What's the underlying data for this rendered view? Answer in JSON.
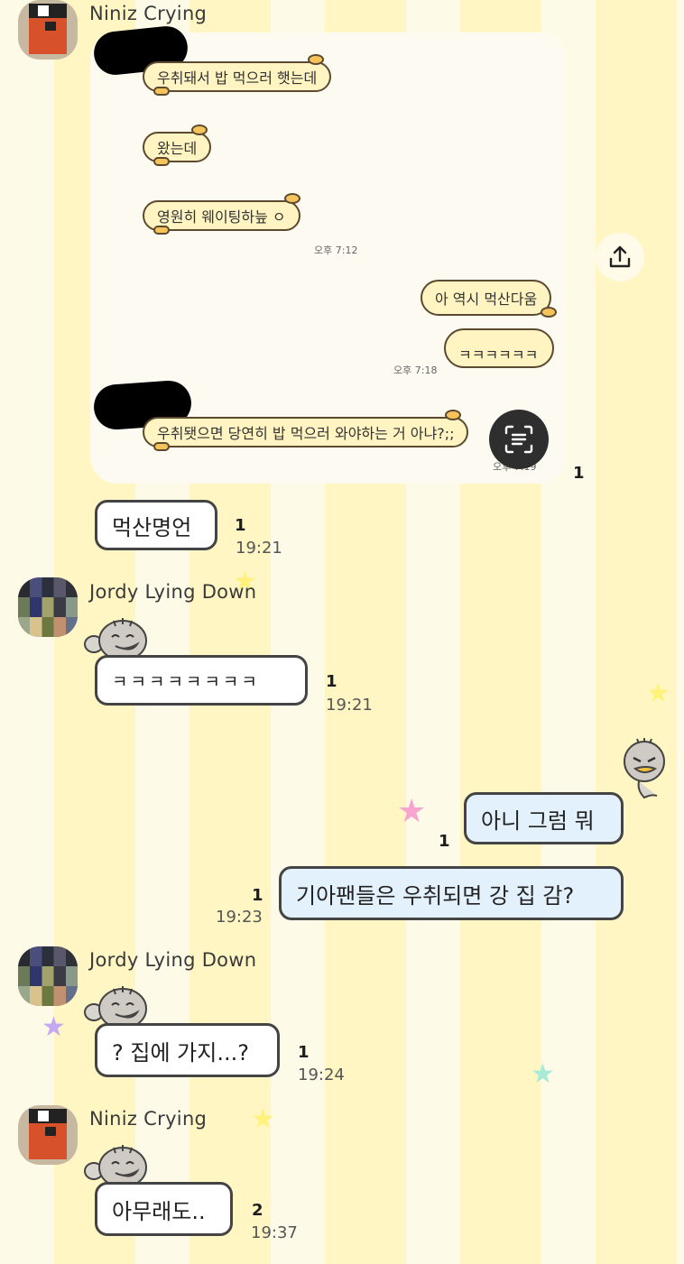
{
  "messages": {
    "m1": {
      "sender": "Niniz Crying",
      "screenshot_unread": "1"
    },
    "m2": {
      "text": "먹산명언",
      "unread": "1",
      "time": "19:21"
    },
    "m3": {
      "sender": "Jordy Lying Down",
      "text": "ㅋㅋㅋㅋㅋㅋㅋㅋ",
      "unread": "1",
      "time": "19:21"
    },
    "m4": {
      "text": "아니 그럼 뭐",
      "unread": "1"
    },
    "m5": {
      "text": "기아팬들은 우취되면 강 집 감?",
      "unread": "1",
      "time": "19:23"
    },
    "m6": {
      "sender": "Jordy Lying Down",
      "text": "? 집에 가지...?",
      "unread": "1",
      "time": "19:24"
    },
    "m7": {
      "sender": "Niniz Crying",
      "text": "아무래도..",
      "unread": "2",
      "time": "19:37"
    }
  },
  "screenshot": {
    "b1": "우취돼서 밥 먹으러 햇는데",
    "b2": "왔는데",
    "b3": "영원히 웨이팅하늪 ㅇ",
    "t1": "오후 7:12",
    "b4": "아 역시 먹산다움",
    "b5": "ㅋㅋㅋㅋㅋㅋ",
    "t2": "오후 7:18",
    "b6": "우취됏으면 당연히 밥 먹으러 와야하는 거 아냐?;;",
    "t3": "오후 7:19"
  },
  "icons": {
    "share": "share-icon",
    "scan": "text-scan-icon"
  },
  "colors": {
    "stripe_light": "#fdfae8",
    "stripe_yellow": "#fff6c4",
    "bubble_blue": "#e3f1fc",
    "bubble_white": "#ffffff",
    "niniz_orange": "#d7512b"
  }
}
